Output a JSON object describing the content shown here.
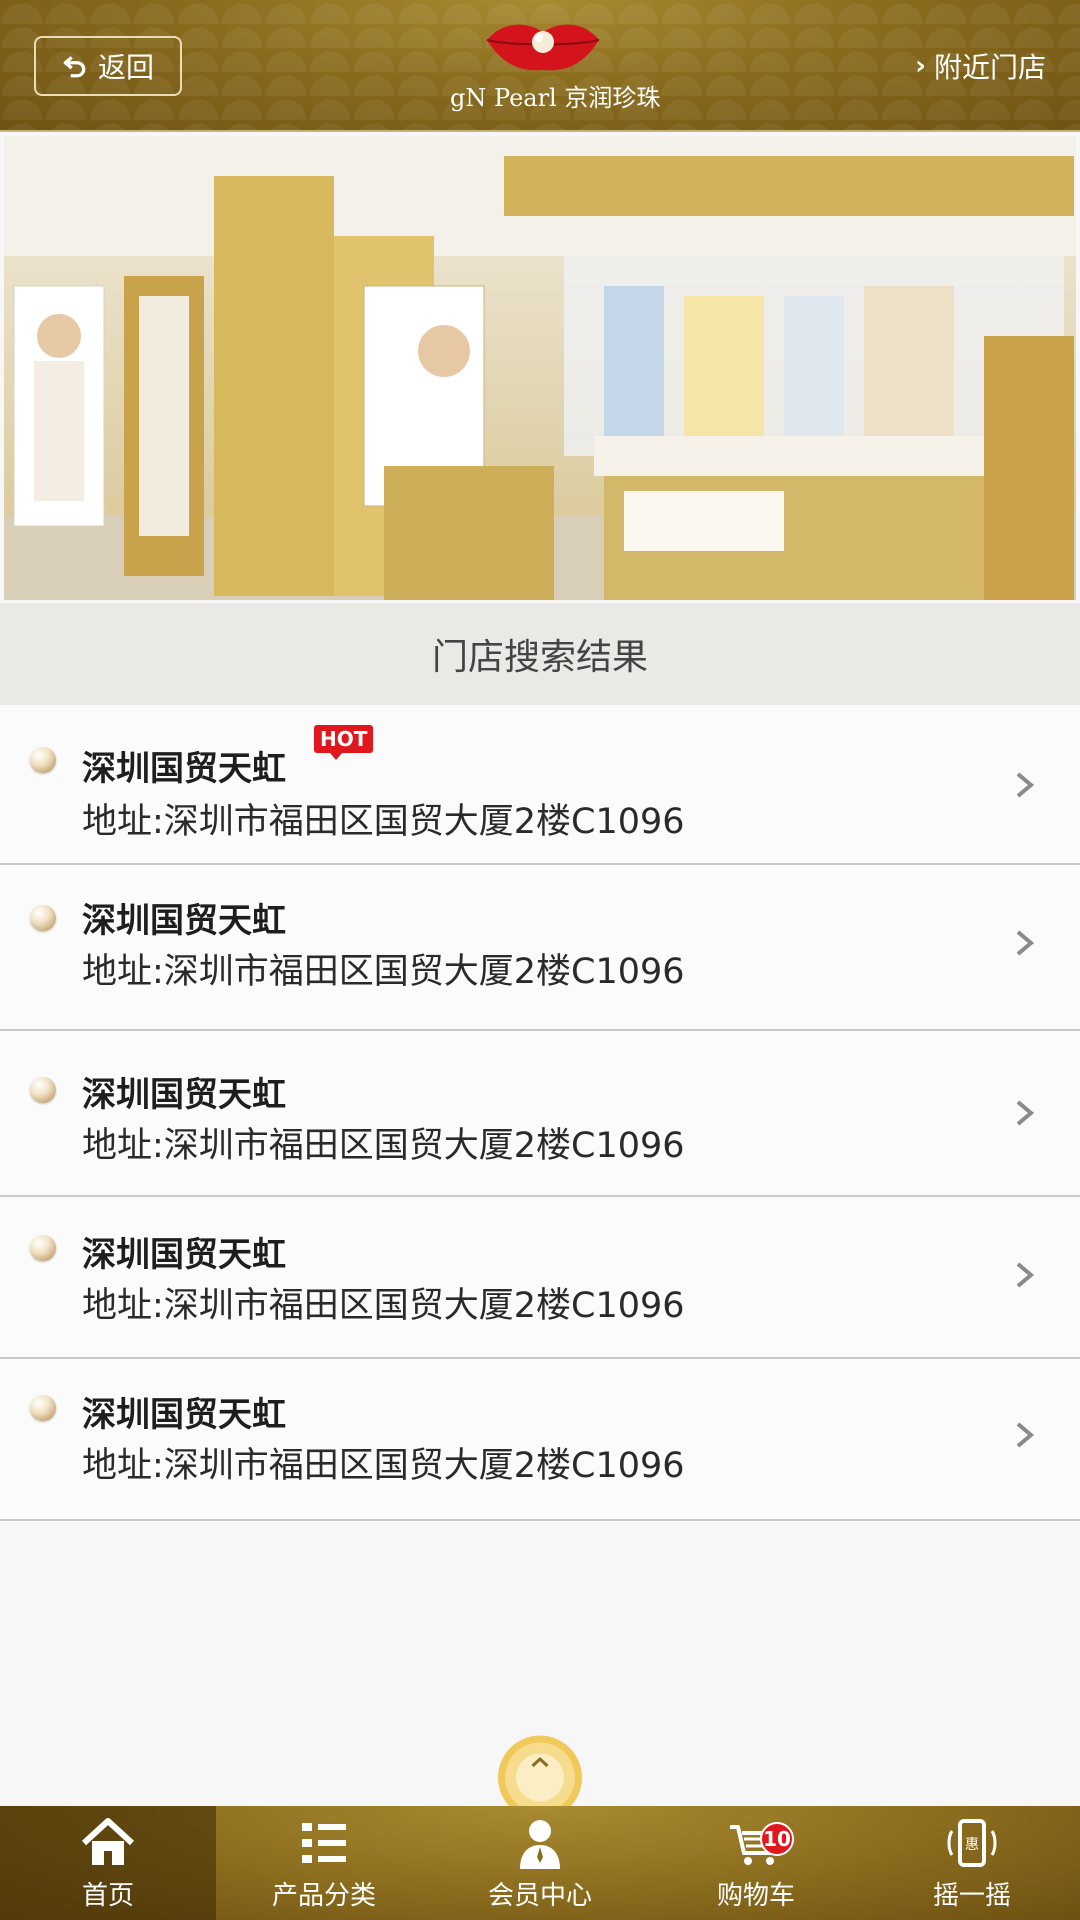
{
  "header": {
    "back_label": "返回",
    "logo_text": "gN Pearl 京润珍珠",
    "nearby_label": "附近门店"
  },
  "hero": {
    "image": "store-photo"
  },
  "section": {
    "title": "门店搜索结果"
  },
  "stores": [
    {
      "name": "深圳国贸天虹",
      "address": "地址:深圳市福田区国贸大厦2楼C1096",
      "hot": "HOT"
    },
    {
      "name": "深圳国贸天虹",
      "address": "地址:深圳市福田区国贸大厦2楼C1096"
    },
    {
      "name": "深圳国贸天虹",
      "address": "地址:深圳市福田区国贸大厦2楼C1096"
    },
    {
      "name": "深圳国贸天虹",
      "address": "地址:深圳市福田区国贸大厦2楼C1096"
    },
    {
      "name": "深圳国贸天虹",
      "address": "地址:深圳市福田区国贸大厦2楼C1096"
    }
  ],
  "tabbar": {
    "items": [
      {
        "label": "首页",
        "icon": "home-icon"
      },
      {
        "label": "产品分类",
        "icon": "list-icon"
      },
      {
        "label": "会员中心",
        "icon": "user-icon"
      },
      {
        "label": "购物车",
        "icon": "cart-icon",
        "badge": "10"
      },
      {
        "label": "摇一摇",
        "icon": "shake-phone-icon",
        "icon_text": "惠"
      }
    ]
  },
  "colors": {
    "gold_dark": "#6f5212",
    "gold": "#8a6c1e",
    "hot_red": "#e0181e"
  }
}
